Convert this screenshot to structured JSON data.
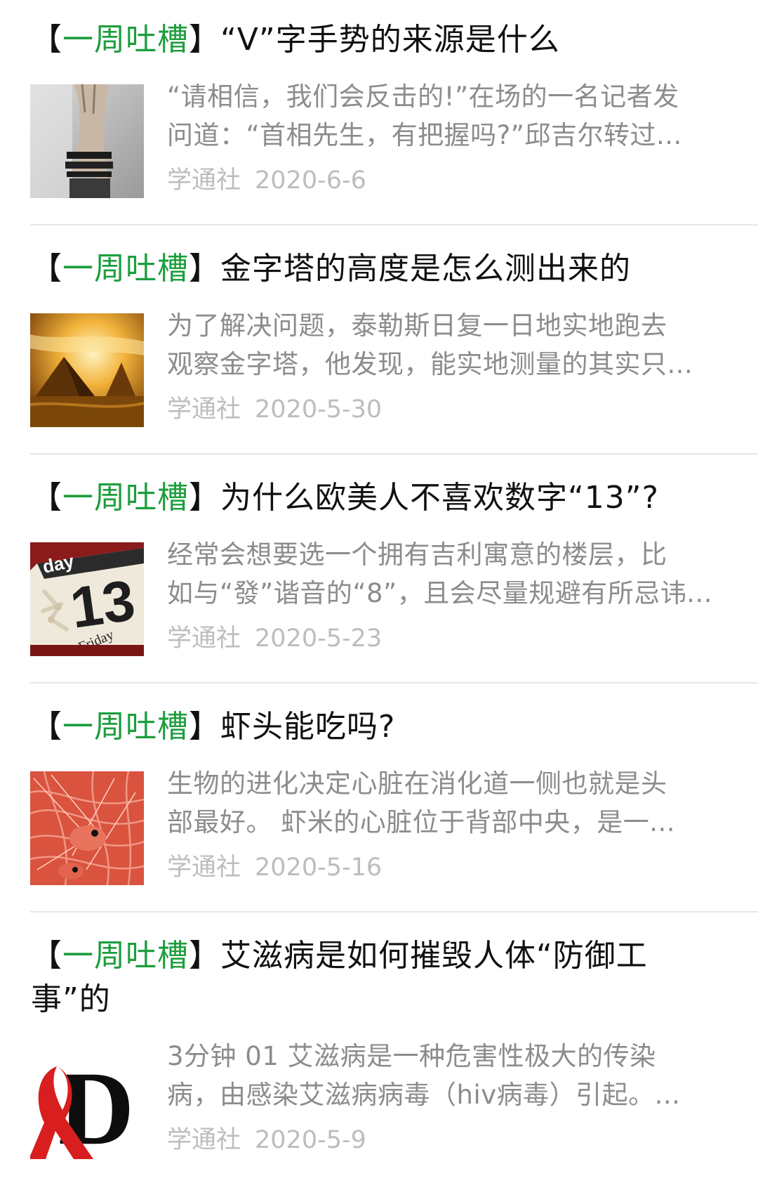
{
  "theme": {
    "tag_color": "#1d9e3d"
  },
  "articles": [
    {
      "bracket_open": "【",
      "tag": "一周吐槽",
      "bracket_close": "】",
      "title": "“V”字手势的来源是什么",
      "summary_line1": "“请相信，我们会反击的!”在场的一名记者发",
      "summary_line2": "问道：“首相先生，有把握吗?”邱吉尔转过...",
      "source": "学通社",
      "date": "2020-6-6",
      "thumbnail_icon": "v-sign-hand-image"
    },
    {
      "bracket_open": "【",
      "tag": "一周吐槽",
      "bracket_close": "】",
      "title": "金字塔的高度是怎么测出来的",
      "summary_line1": "为了解决问题，泰勒斯日复一日地实地跑去",
      "summary_line2": "观察金字塔，他发现，能实地测量的其实只...",
      "source": "学通社",
      "date": "2020-5-30",
      "thumbnail_icon": "pyramid-sunset-image"
    },
    {
      "bracket_open": "【",
      "tag": "一周吐槽",
      "bracket_close": "】",
      "title": "为什么欧美人不喜欢数字“13”?",
      "summary_line1": "经常会想要选一个拥有吉利寓意的楼层，比",
      "summary_line2": "如与“發”谐音的“8”，且会尽量规避有所忌讳...",
      "source": "学通社",
      "date": "2020-5-23",
      "thumbnail_icon": "friday-13-calendar-image",
      "thumb_text_top": "day",
      "thumb_number": "13",
      "thumb_text_bottom": "Friday"
    },
    {
      "bracket_open": "【",
      "tag": "一周吐槽",
      "bracket_close": "】",
      "title": "虾头能吃吗?",
      "summary_line1": "生物的进化决定心脏在消化道一侧也就是头",
      "summary_line2": "部最好。 虾米的心脏位于背部中央，是一...",
      "source": "学通社",
      "date": "2020-5-16",
      "thumbnail_icon": "shrimp-image"
    },
    {
      "bracket_open": "【",
      "tag": "一周吐槽",
      "bracket_close": "】",
      "title": "艾滋病是如何摧毁人体“防御工事”的",
      "summary_line1": "3分钟 01 艾滋病是一种危害性极大的传染",
      "summary_line2": "病，由感染艾滋病病毒（hiv病毒）引起。...",
      "source": "学通社",
      "date": "2020-5-9",
      "thumbnail_icon": "red-ribbon-d-image",
      "thumb_letter": "D"
    }
  ]
}
